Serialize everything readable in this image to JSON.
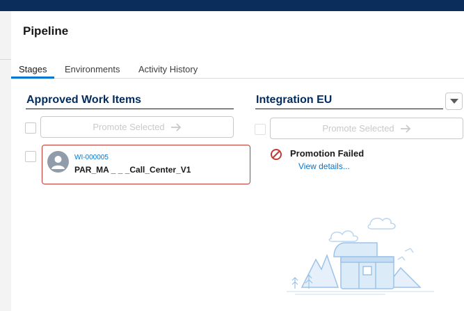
{
  "page": {
    "title": "Pipeline"
  },
  "tabs": [
    {
      "label": "Stages",
      "active": true
    },
    {
      "label": "Environments",
      "active": false
    },
    {
      "label": "Activity History",
      "active": false
    }
  ],
  "approved": {
    "title": "Approved Work Items",
    "promote_label": "Promote Selected",
    "items": [
      {
        "id": "WI-000005",
        "name": "PAR_MA _ _ _Call_Center_V1",
        "status": "error"
      }
    ]
  },
  "integration": {
    "title": "Integration EU",
    "promote_label": "Promote Selected",
    "status_text": "Promotion Failed",
    "view_details_label": "View details..."
  },
  "colors": {
    "brand_blue": "#0176d3",
    "header_navy": "#0b2d5b",
    "error_red": "#c23934"
  },
  "icons": {
    "arrow": "arrow-right-icon",
    "avatar": "user-avatar-icon",
    "fail": "prohibited-icon",
    "dropdown": "chevron-down-icon"
  }
}
